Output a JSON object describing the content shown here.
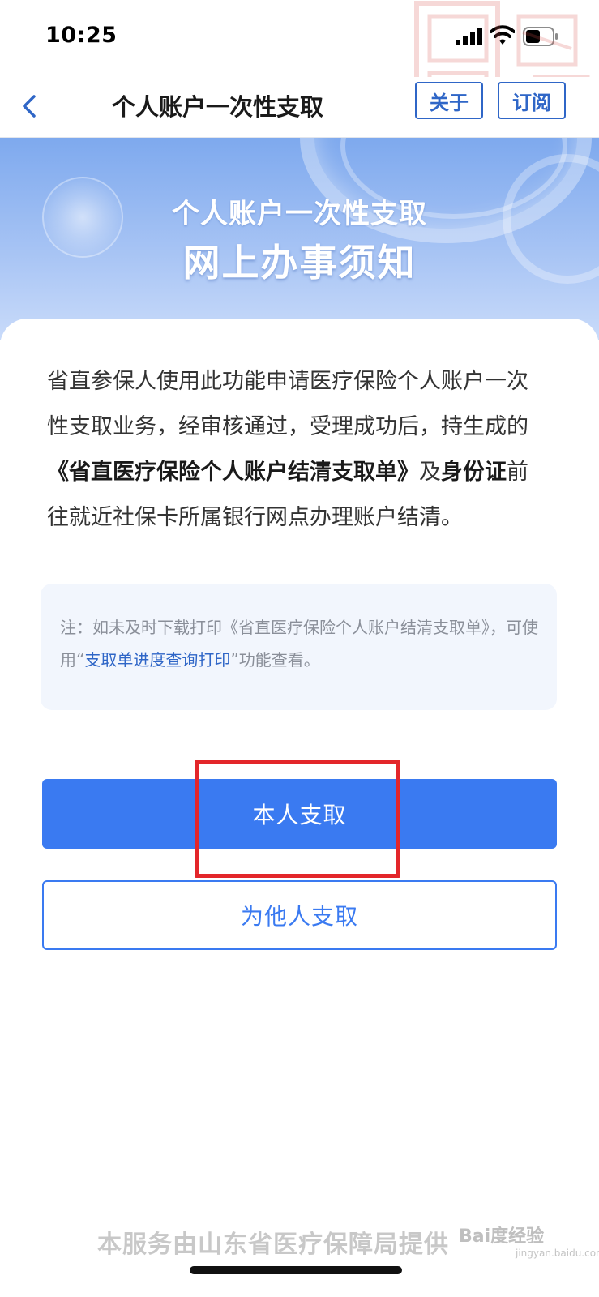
{
  "status_bar": {
    "time": "10:25"
  },
  "header": {
    "title": "个人账户一次性支取",
    "about_label": "关于",
    "subscribe_label": "订阅"
  },
  "banner": {
    "line1": "个人账户一次性支取",
    "line2": "网上办事须知"
  },
  "content": {
    "intro_part1": "省直参保人使用此功能申请医疗保险个人账户一次性支取业务，经审核通过，受理成功后，持生成的",
    "intro_bold1": "《省直医疗保险个人账户结清支取单》",
    "intro_part2": "及",
    "intro_bold2": "身份证",
    "intro_part3": "前往就近社保卡所属银行网点办理账户结清。",
    "note_prefix": "注：如未及时下载打印《省直医疗保险个人账户结清支取单》，可使用“",
    "note_link": "支取单进度查询打印",
    "note_suffix": "”功能查看。"
  },
  "buttons": {
    "self_withdraw": "本人支取",
    "withdraw_for_others": "为他人支取"
  },
  "footer": {
    "provider_text": "本服务由山东省医疗保障局提供",
    "watermark_text": "Bai度经验",
    "watermark_sub": "jingyan.baidu.com"
  },
  "colors": {
    "accent": "#3a7af1",
    "header_btn": "#2f66c7",
    "highlight": "#e3262a"
  }
}
